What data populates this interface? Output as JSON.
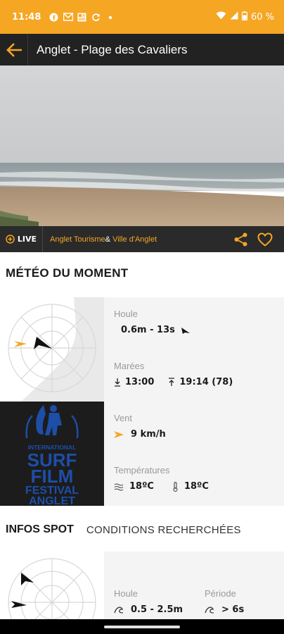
{
  "status": {
    "time": "11:48",
    "battery": "60 %"
  },
  "header": {
    "title": "Anglet - Plage des Cavaliers"
  },
  "camera": {
    "live_label": "LIVE",
    "credit_1": "Anglet Tourisme",
    "separator": "&",
    "credit_2": "Ville d'Anglet"
  },
  "meteo": {
    "section_title": "MÉTÉO DU MOMENT",
    "houle_label": "Houle",
    "houle_value": "0.6m - 13s",
    "marees_label": "Marées",
    "maree_low": "13:00",
    "maree_high": "19:14 (78)",
    "vent_label": "Vent",
    "vent_value": "9 km/h",
    "temperatures_label": "Températures",
    "temp_water": "18ºC",
    "temp_air": "18ºC"
  },
  "festival": {
    "line1": "INTERNATIONAL",
    "line2": "SURF",
    "line3": "FILM",
    "line4": "FESTIVAL",
    "line5": "ANGLET"
  },
  "tabs": {
    "active": "INFOS SPOT",
    "other": "CONDITIONS RECHERCHÉES"
  },
  "spot": {
    "houle_label": "Houle",
    "houle_value": "0.5 - 2.5m",
    "periode_label": "Période",
    "periode_value": "> 6s"
  },
  "colors": {
    "accent": "#f5a623",
    "dark": "#222222",
    "festival_blue": "#1d4ea8"
  }
}
